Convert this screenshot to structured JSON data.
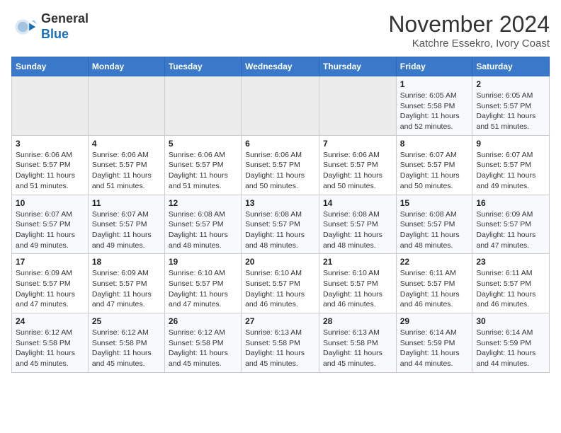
{
  "header": {
    "logo_line1": "General",
    "logo_line2": "Blue",
    "month_title": "November 2024",
    "location": "Katchre Essekro, Ivory Coast"
  },
  "days_of_week": [
    "Sunday",
    "Monday",
    "Tuesday",
    "Wednesday",
    "Thursday",
    "Friday",
    "Saturday"
  ],
  "weeks": [
    [
      {
        "day": "",
        "info": ""
      },
      {
        "day": "",
        "info": ""
      },
      {
        "day": "",
        "info": ""
      },
      {
        "day": "",
        "info": ""
      },
      {
        "day": "",
        "info": ""
      },
      {
        "day": "1",
        "info": "Sunrise: 6:05 AM\nSunset: 5:58 PM\nDaylight: 11 hours and 52 minutes."
      },
      {
        "day": "2",
        "info": "Sunrise: 6:05 AM\nSunset: 5:57 PM\nDaylight: 11 hours and 51 minutes."
      }
    ],
    [
      {
        "day": "3",
        "info": "Sunrise: 6:06 AM\nSunset: 5:57 PM\nDaylight: 11 hours and 51 minutes."
      },
      {
        "day": "4",
        "info": "Sunrise: 6:06 AM\nSunset: 5:57 PM\nDaylight: 11 hours and 51 minutes."
      },
      {
        "day": "5",
        "info": "Sunrise: 6:06 AM\nSunset: 5:57 PM\nDaylight: 11 hours and 51 minutes."
      },
      {
        "day": "6",
        "info": "Sunrise: 6:06 AM\nSunset: 5:57 PM\nDaylight: 11 hours and 50 minutes."
      },
      {
        "day": "7",
        "info": "Sunrise: 6:06 AM\nSunset: 5:57 PM\nDaylight: 11 hours and 50 minutes."
      },
      {
        "day": "8",
        "info": "Sunrise: 6:07 AM\nSunset: 5:57 PM\nDaylight: 11 hours and 50 minutes."
      },
      {
        "day": "9",
        "info": "Sunrise: 6:07 AM\nSunset: 5:57 PM\nDaylight: 11 hours and 49 minutes."
      }
    ],
    [
      {
        "day": "10",
        "info": "Sunrise: 6:07 AM\nSunset: 5:57 PM\nDaylight: 11 hours and 49 minutes."
      },
      {
        "day": "11",
        "info": "Sunrise: 6:07 AM\nSunset: 5:57 PM\nDaylight: 11 hours and 49 minutes."
      },
      {
        "day": "12",
        "info": "Sunrise: 6:08 AM\nSunset: 5:57 PM\nDaylight: 11 hours and 48 minutes."
      },
      {
        "day": "13",
        "info": "Sunrise: 6:08 AM\nSunset: 5:57 PM\nDaylight: 11 hours and 48 minutes."
      },
      {
        "day": "14",
        "info": "Sunrise: 6:08 AM\nSunset: 5:57 PM\nDaylight: 11 hours and 48 minutes."
      },
      {
        "day": "15",
        "info": "Sunrise: 6:08 AM\nSunset: 5:57 PM\nDaylight: 11 hours and 48 minutes."
      },
      {
        "day": "16",
        "info": "Sunrise: 6:09 AM\nSunset: 5:57 PM\nDaylight: 11 hours and 47 minutes."
      }
    ],
    [
      {
        "day": "17",
        "info": "Sunrise: 6:09 AM\nSunset: 5:57 PM\nDaylight: 11 hours and 47 minutes."
      },
      {
        "day": "18",
        "info": "Sunrise: 6:09 AM\nSunset: 5:57 PM\nDaylight: 11 hours and 47 minutes."
      },
      {
        "day": "19",
        "info": "Sunrise: 6:10 AM\nSunset: 5:57 PM\nDaylight: 11 hours and 47 minutes."
      },
      {
        "day": "20",
        "info": "Sunrise: 6:10 AM\nSunset: 5:57 PM\nDaylight: 11 hours and 46 minutes."
      },
      {
        "day": "21",
        "info": "Sunrise: 6:10 AM\nSunset: 5:57 PM\nDaylight: 11 hours and 46 minutes."
      },
      {
        "day": "22",
        "info": "Sunrise: 6:11 AM\nSunset: 5:57 PM\nDaylight: 11 hours and 46 minutes."
      },
      {
        "day": "23",
        "info": "Sunrise: 6:11 AM\nSunset: 5:57 PM\nDaylight: 11 hours and 46 minutes."
      }
    ],
    [
      {
        "day": "24",
        "info": "Sunrise: 6:12 AM\nSunset: 5:58 PM\nDaylight: 11 hours and 45 minutes."
      },
      {
        "day": "25",
        "info": "Sunrise: 6:12 AM\nSunset: 5:58 PM\nDaylight: 11 hours and 45 minutes."
      },
      {
        "day": "26",
        "info": "Sunrise: 6:12 AM\nSunset: 5:58 PM\nDaylight: 11 hours and 45 minutes."
      },
      {
        "day": "27",
        "info": "Sunrise: 6:13 AM\nSunset: 5:58 PM\nDaylight: 11 hours and 45 minutes."
      },
      {
        "day": "28",
        "info": "Sunrise: 6:13 AM\nSunset: 5:58 PM\nDaylight: 11 hours and 45 minutes."
      },
      {
        "day": "29",
        "info": "Sunrise: 6:14 AM\nSunset: 5:59 PM\nDaylight: 11 hours and 44 minutes."
      },
      {
        "day": "30",
        "info": "Sunrise: 6:14 AM\nSunset: 5:59 PM\nDaylight: 11 hours and 44 minutes."
      }
    ]
  ]
}
